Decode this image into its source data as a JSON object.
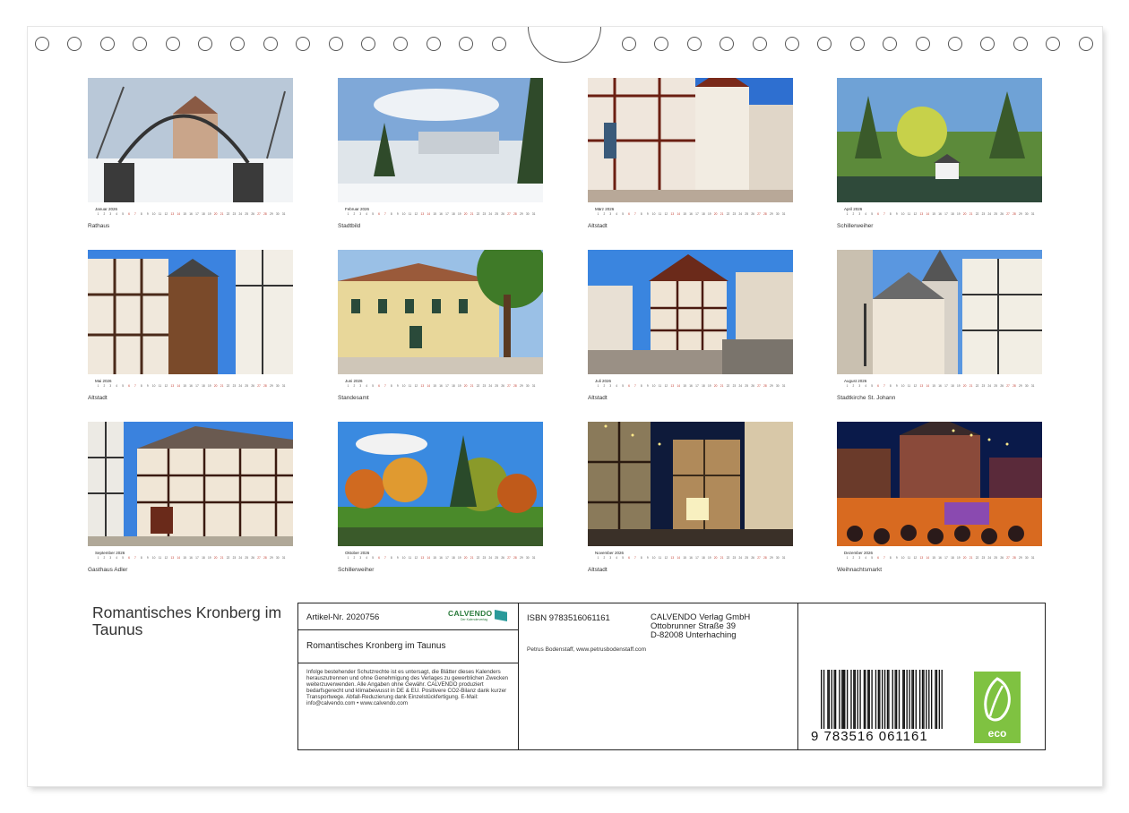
{
  "months": [
    {
      "name": "Januar 2026",
      "caption": "Rathaus",
      "scene": "winter-gate"
    },
    {
      "name": "Februar 2026",
      "caption": "Stadtbild",
      "scene": "winter-town"
    },
    {
      "name": "März 2026",
      "caption": "Altstadt",
      "scene": "timber-street"
    },
    {
      "name": "April 2026",
      "caption": "Schillerweiher",
      "scene": "pond-spring"
    },
    {
      "name": "Mai 2026",
      "caption": "Altstadt",
      "scene": "timber-tower"
    },
    {
      "name": "Juni 2026",
      "caption": "Standesamt",
      "scene": "yellow-house"
    },
    {
      "name": "Juli 2026",
      "caption": "Altstadt",
      "scene": "timber-square"
    },
    {
      "name": "August 2026",
      "caption": "Stadtkirche St. Johann",
      "scene": "church"
    },
    {
      "name": "September 2026",
      "caption": "Gasthaus Adler",
      "scene": "gasthaus"
    },
    {
      "name": "Oktober 2026",
      "caption": "Schillerweiher",
      "scene": "autumn-park"
    },
    {
      "name": "November 2026",
      "caption": "Altstadt",
      "scene": "night-street"
    },
    {
      "name": "Dezember 2026",
      "caption": "Weihnachtsmarkt",
      "scene": "christmas-market"
    }
  ],
  "calendar_days": [
    "1",
    "2",
    "3",
    "4",
    "5",
    "6",
    "7",
    "8",
    "9",
    "10",
    "11",
    "12",
    "13",
    "14",
    "15",
    "16",
    "17",
    "18",
    "19",
    "20",
    "21",
    "22",
    "23",
    "24",
    "25",
    "26",
    "27",
    "28",
    "29",
    "30",
    "31"
  ],
  "title": "Romantisches Kronberg im Taunus",
  "info": {
    "artikel": "Artikel-Nr. 2020756",
    "logo_text": "CALVENDO",
    "logo_sub": "Der Kalenderverlag",
    "title": "Romantisches Kronberg im Taunus",
    "legal": "Infolge bestehender Schutzrechte ist es untersagt, die Blätter dieses Kalenders herauszutrennen und ohne Genehmigung des Verlages zu gewerblichen Zwecken weiterzuverwenden. Alle Angaben ohne Gewähr. CALVENDO produziert bedarfsgerecht und klimabewusst in DE & EU. Positivere CO2-Bilanz dank kurzer Transportwege. Abfall-Reduzierung dank Einzelstückfertigung. E-Mail: info@calvendo.com • www.calvendo.com",
    "isbn": "ISBN 9783516061161",
    "publisher_line1": "CALVENDO Verlag GmbH",
    "publisher_line2": "Ottobrunner Straße 39",
    "publisher_line3": "D-82008 Unterhaching",
    "author": "Petrus Bodenstaff, www.petrusbodenstaff.com",
    "barcode_number": "9  783516  061161",
    "eco_label": "eco"
  },
  "colors": {
    "border": "#222222",
    "weekend": "#c0392b",
    "eco": "#7fc241",
    "calvendo": "#2a7a3b"
  }
}
